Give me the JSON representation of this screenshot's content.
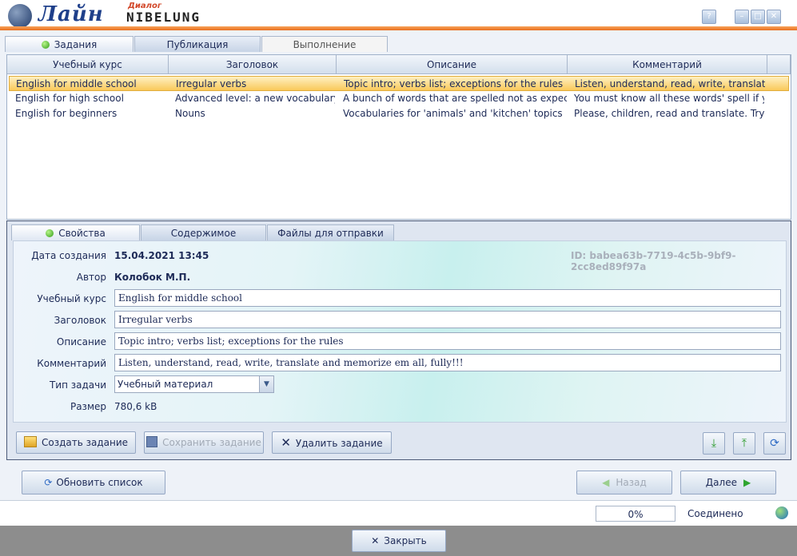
{
  "app": {
    "logo_text": "Лайн",
    "sublogo_small": "Диалог",
    "sublogo_big": "NIBELUNG",
    "help_label": "?"
  },
  "top_tabs": [
    {
      "label": "Задания",
      "active": true
    },
    {
      "label": "Публикация",
      "active": false
    },
    {
      "label": "Выполнение",
      "active": false
    }
  ],
  "grid": {
    "columns": [
      "Учебный курс",
      "Заголовок",
      "Описание",
      "Комментарий"
    ],
    "rows": [
      {
        "course": "English for middle school",
        "title": "Irregular verbs",
        "description": "Topic intro; verbs list; exceptions for the rules",
        "comment": "Listen, understand, read, write, translate and r",
        "selected": true
      },
      {
        "course": "English for high school",
        "title": "Advanced level: a new vocabulary",
        "description": "A bunch of words that are spelled not as expected!",
        "comment": "You must know all these words' spell if you ar"
      },
      {
        "course": "English for beginners",
        "title": "Nouns",
        "description": "Vocabularies for 'animals' and 'kitchen' topics",
        "comment": "Please, children, read and translate. Try to bec"
      }
    ]
  },
  "detail_tabs": [
    {
      "label": "Свойства",
      "active": true
    },
    {
      "label": "Содержимое",
      "active": false
    },
    {
      "label": "Файлы для отправки",
      "active": false
    }
  ],
  "properties": {
    "created_label": "Дата создания",
    "created_value": "15.04.2021 13:45",
    "id_text": "ID: babea63b-7719-4c5b-9bf9-2cc8ed89f97a",
    "author_label": "Автор",
    "author_value": "Колобок М.П.",
    "course_label": "Учебный курс",
    "course_value": "English for middle school",
    "title_label": "Заголовок",
    "title_value": "Irregular verbs",
    "description_label": "Описание",
    "description_value": "Topic intro; verbs list; exceptions for the rules",
    "comment_label": "Комментарий",
    "comment_value": "Listen, understand, read, write, translate and memorize em all, fully!!!",
    "type_label": "Тип задачи",
    "type_value": "Учебный материал",
    "size_label": "Размер",
    "size_value": "780,6 kB"
  },
  "actions": {
    "create": "Создать задание",
    "save": "Сохранить задание",
    "delete": "Удалить задание"
  },
  "nav": {
    "refresh": "Обновить список",
    "back": "Назад",
    "next": "Далее"
  },
  "status": {
    "progress": "0%",
    "connection": "Соединено"
  },
  "footer": {
    "close": "Закрыть"
  }
}
